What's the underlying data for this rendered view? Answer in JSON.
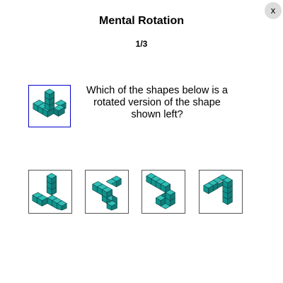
{
  "header": {
    "title": "Mental Rotation",
    "progress": "1/3",
    "close_label": "x"
  },
  "question": {
    "text": "Which of the shapes below is a rotated version of the shape shown left?"
  },
  "colors": {
    "cube_top": "#2fbdb6",
    "cube_left": "#0f938d",
    "cube_right": "#137a76",
    "cube_edge": "#0a3f3d",
    "target_border": "#0000cc",
    "option_border": "#555555",
    "close_bg": "#dcdcdc"
  },
  "options": [
    {
      "label": "",
      "icon": "cube-shape-1"
    },
    {
      "label": "",
      "icon": "cube-shape-2"
    },
    {
      "label": "",
      "icon": "cube-shape-3"
    },
    {
      "label": "",
      "icon": "cube-shape-4"
    }
  ]
}
